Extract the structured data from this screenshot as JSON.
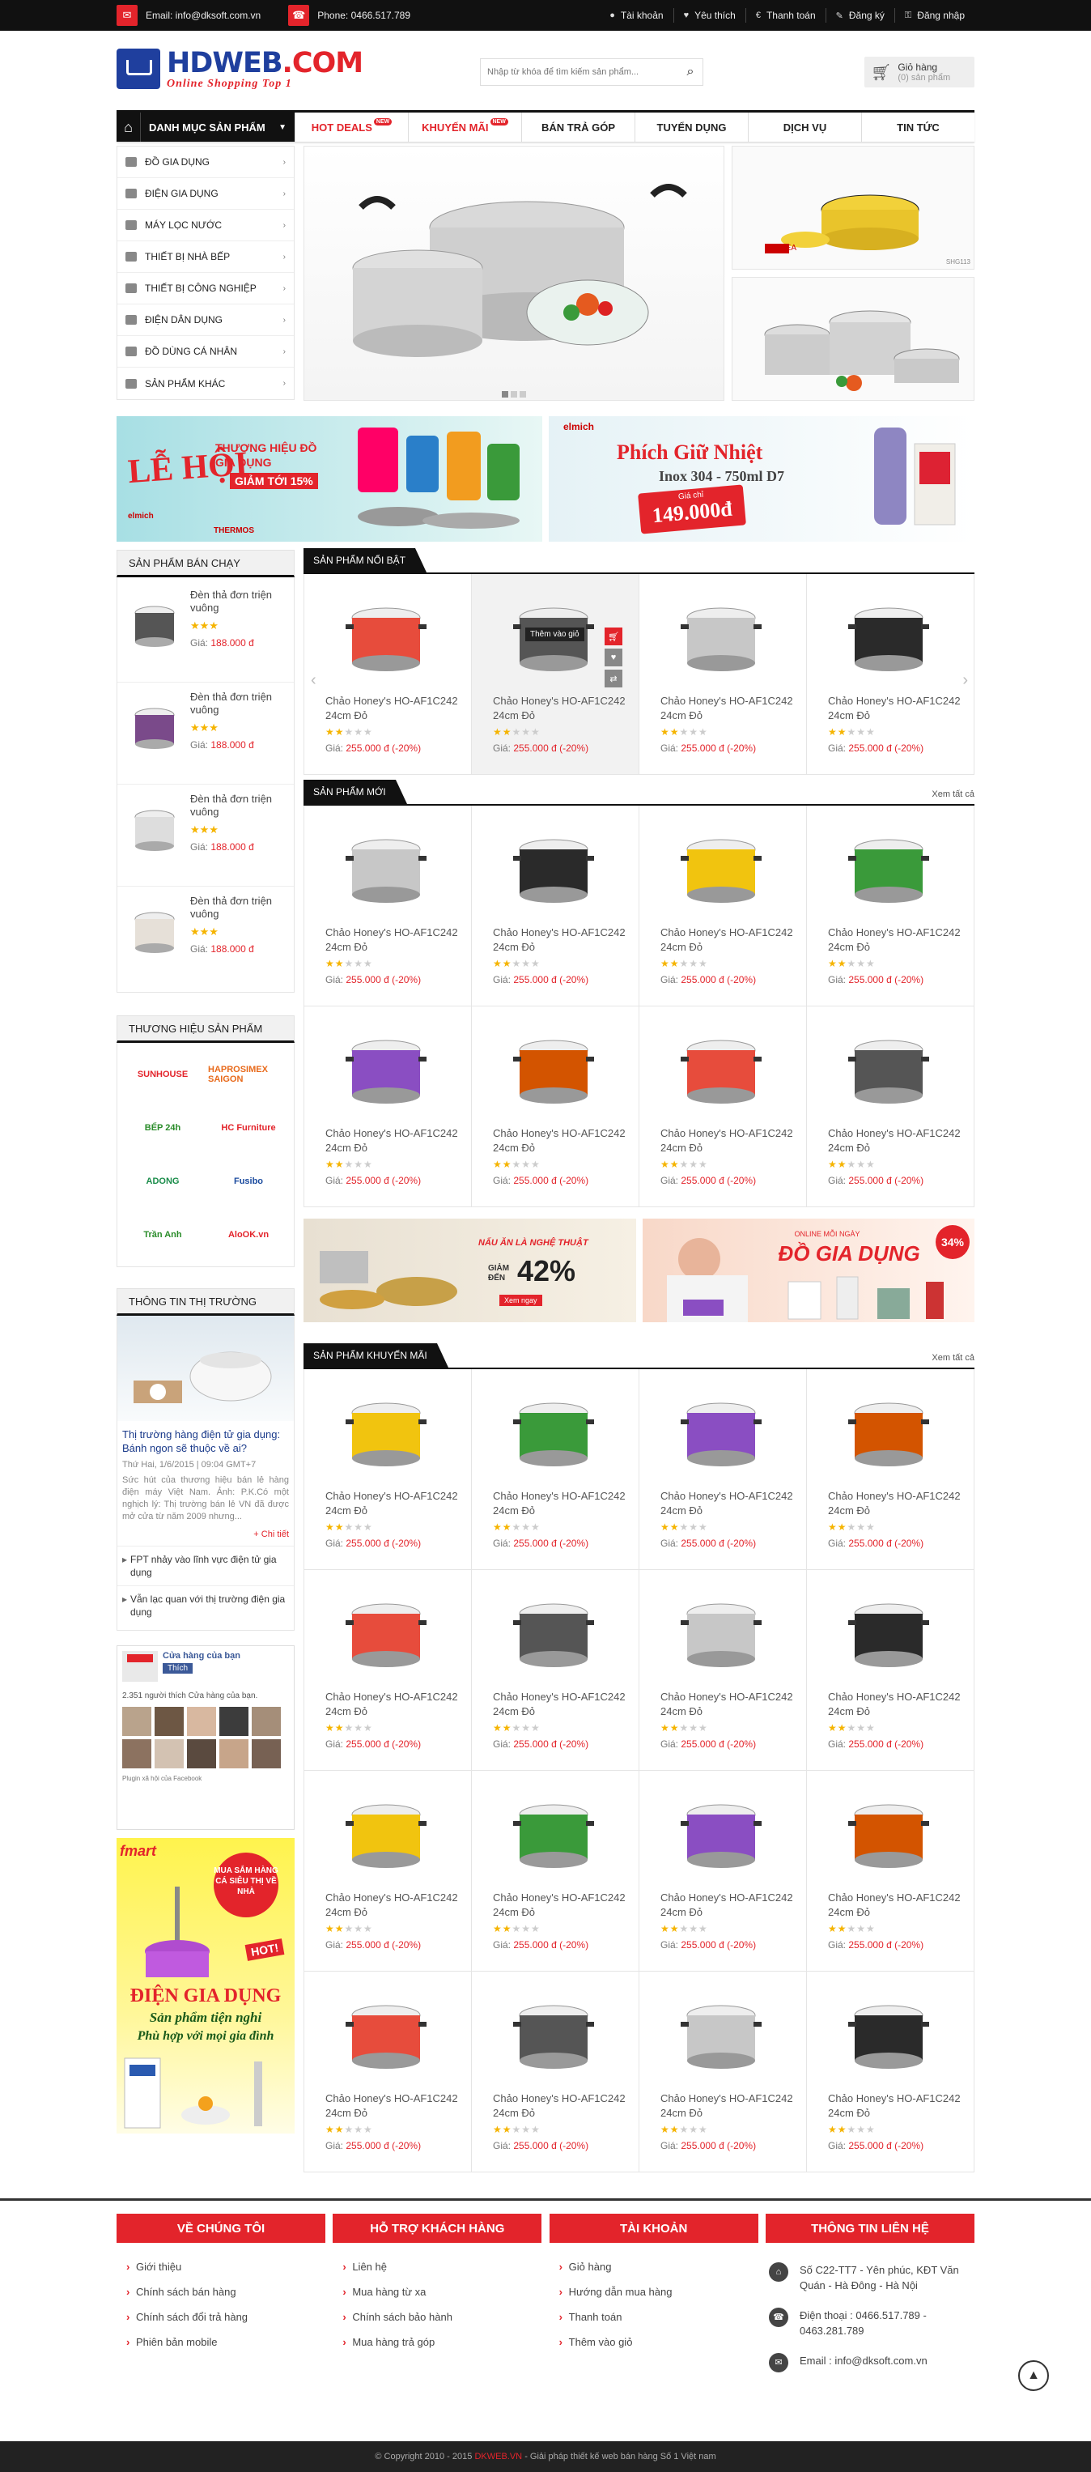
{
  "topbar": {
    "email": "Email: info@dksoft.com.vn",
    "phone": "Phone: 0466.517.789",
    "links": [
      "Tài khoản",
      "Yêu thích",
      "Thanh toán",
      "Đăng ký",
      "Đăng nhập"
    ]
  },
  "header": {
    "logo_main": "HDWEB",
    "logo_suffix": ".COM",
    "logo_tagline": "Online Shopping Top 1",
    "search_placeholder": "Nhập từ khóa để tìm kiếm sản phẩm...",
    "cart_title": "Giỏ hàng",
    "cart_count": "(0) sản phẩm"
  },
  "nav": {
    "category": "Danh mục sản phẩm",
    "items": [
      {
        "label": "Hot deals",
        "badge": "new",
        "red": true
      },
      {
        "label": "Khuyến mãi",
        "badge": "new",
        "red": true
      },
      {
        "label": "Bán trả góp"
      },
      {
        "label": "Tuyển dụng"
      },
      {
        "label": "Dịch vụ"
      },
      {
        "label": "Tin tức"
      }
    ]
  },
  "side_menu": [
    "Đồ gia dụng",
    "Điện gia dụng",
    "Máy lọc nước",
    "Thiết bị nhà bếp",
    "Thiết bị công nghiệp",
    "Điện dân dụng",
    "Đồ dùng cá nhân",
    "Sản phẩm khác"
  ],
  "banners": {
    "b1_title": "LỄ HỘI",
    "b1_sub": "THƯƠNG HIỆU ĐỒ GIA DỤNG",
    "b1_sale": "GIẢM TỚI 15%",
    "b1_brand1": "elmich",
    "b1_brand2": "THERMOS",
    "b2_brand": "elmich",
    "b2_title": "Phích Giữ Nhiệt",
    "b2_sub": "Inox 304 - 750ml D7",
    "b2_label": "Giá chỉ",
    "b2_price": "149.000đ"
  },
  "thumbs": {
    "t1_brand": "KOREA",
    "t1_code": "SHG113"
  },
  "sidebar": {
    "best_title": "Sản phẩm bán chạy",
    "best": [
      {
        "name": "Đèn thả đơn triện vuông",
        "stars": "★★★",
        "price_label": "Giá:",
        "price": "188.000 đ"
      },
      {
        "name": "Đèn thả đơn triện vuông",
        "stars": "★★★",
        "price_label": "Giá:",
        "price": "188.000 đ"
      },
      {
        "name": "Đèn thả đơn triện vuông",
        "stars": "★★★",
        "price_label": "Giá:",
        "price": "188.000 đ"
      },
      {
        "name": "Đèn thả đơn triện vuông",
        "stars": "★★★",
        "price_label": "Giá:",
        "price": "188.000 đ"
      }
    ],
    "brands_title": "Thương hiệu sản phẩm",
    "brands": [
      {
        "name": "SUNHOUSE",
        "color": "#e3242b"
      },
      {
        "name": "HAPROSIMEX SAIGON",
        "color": "#e86a1b"
      },
      {
        "name": "BẾP 24h",
        "color": "#2a8c2a"
      },
      {
        "name": "HC Furniture",
        "color": "#e3242b"
      },
      {
        "name": "ADONG",
        "color": "#1a8c4a"
      },
      {
        "name": "Fusibo",
        "color": "#1a4a9e"
      },
      {
        "name": "Trần Anh",
        "color": "#2a8c2a"
      },
      {
        "name": "AloOK.vn",
        "color": "#e3242b"
      }
    ],
    "news_title": "Thông tin thị trường",
    "news_headline": "Thị trường hàng điện tử gia dụng: Bánh ngon sẽ thuộc về ai?",
    "news_date": "Thứ Hai, 1/6/2015 | 09:04 GMT+7",
    "news_desc": "Sức hút của thương hiệu bán lẻ hàng điện máy Việt Nam. Ảnh: P.K.Có một nghịch lý: Thị trường bán lẻ VN đã được mở cửa từ năm 2009 nhưng...",
    "news_more": "+ Chi tiết",
    "news_links": [
      "FPT nhảy vào lĩnh vực điện tử gia dụng",
      "Vẫn lạc quan với thị trường điện gia dụng"
    ],
    "fb_name": "Cửa hàng của bạn",
    "fb_like": "Thích",
    "fb_count_text": "2.351 người thích Cửa hàng của bạn.",
    "fb_plugin": "Plugin xã hội của Facebook",
    "ad_title": "MUA SẮM HÀNG CÁ SIÊU THỊ VỀ NHÀ",
    "ad_hot": "HOT!",
    "ad_head": "ĐIỆN GIA DỤNG",
    "ad_line1": "Sản phẩm tiện nghi",
    "ad_line2": "Phù hợp với mọi gia đình",
    "ad_logo": "fmart"
  },
  "sections": {
    "featured": "Sản phẩm nổi bật",
    "new": "Sản phẩm mới",
    "promo": "Sản phẩm khuyến mãi",
    "see_all": "Xem tất cả",
    "add_cart": "Thêm vào giỏ"
  },
  "product": {
    "name": "Chảo Honey's HO-AF1C242 24cm Đỏ",
    "price_label": "Giá:",
    "price": "255.000 đ (-20%)",
    "stars": "★★",
    "stars_off": "★★★"
  },
  "mid_banners": {
    "m1_title": "NẤU ĂN LÀ NGHỆ THUẬT",
    "m1_sale": "GIẢM ĐẾN",
    "m1_pct": "42%",
    "m1_btn": "Xem ngay",
    "m2_small": "ONLINE MỖI NGÀY",
    "m2_title": "ĐỒ GIA DỤNG",
    "m2_pct": "34%"
  },
  "footer": {
    "cols": [
      {
        "title": "Về chúng tôi",
        "links": [
          "Giới thiệu",
          "Chính sách bán hàng",
          "Chính sách đổi trả hàng",
          "Phiên bản mobile"
        ]
      },
      {
        "title": "Hỗ trợ khách hàng",
        "links": [
          "Liên hệ",
          "Mua hàng từ xa",
          "Chính sách bảo hành",
          "Mua hàng trả góp"
        ]
      },
      {
        "title": "Tài khoản",
        "links": [
          "Giỏ hàng",
          "Hướng dẫn mua hàng",
          "Thanh toán",
          "Thêm vào giỏ"
        ]
      }
    ],
    "contact_title": "Thông tin liên hệ",
    "address": "Số C22-TT7 - Yên phúc, KĐT Văn Quán - Hà Đông - Hà Nội",
    "phone": "Điện thoại : 0466.517.789 - 0463.281.789",
    "email": "Email : info@dksoft.com.vn"
  },
  "copyright": {
    "pre": "© Copyright 2010 - 2015",
    "brand": "DKWEB.VN",
    "post": "- Giải pháp thiết kế web bán hàng Số 1 Việt nam"
  },
  "colors": {
    "accent": "#e3242b",
    "dark": "#111111",
    "brand_blue": "#1f3f9e",
    "star": "#f5b400"
  }
}
